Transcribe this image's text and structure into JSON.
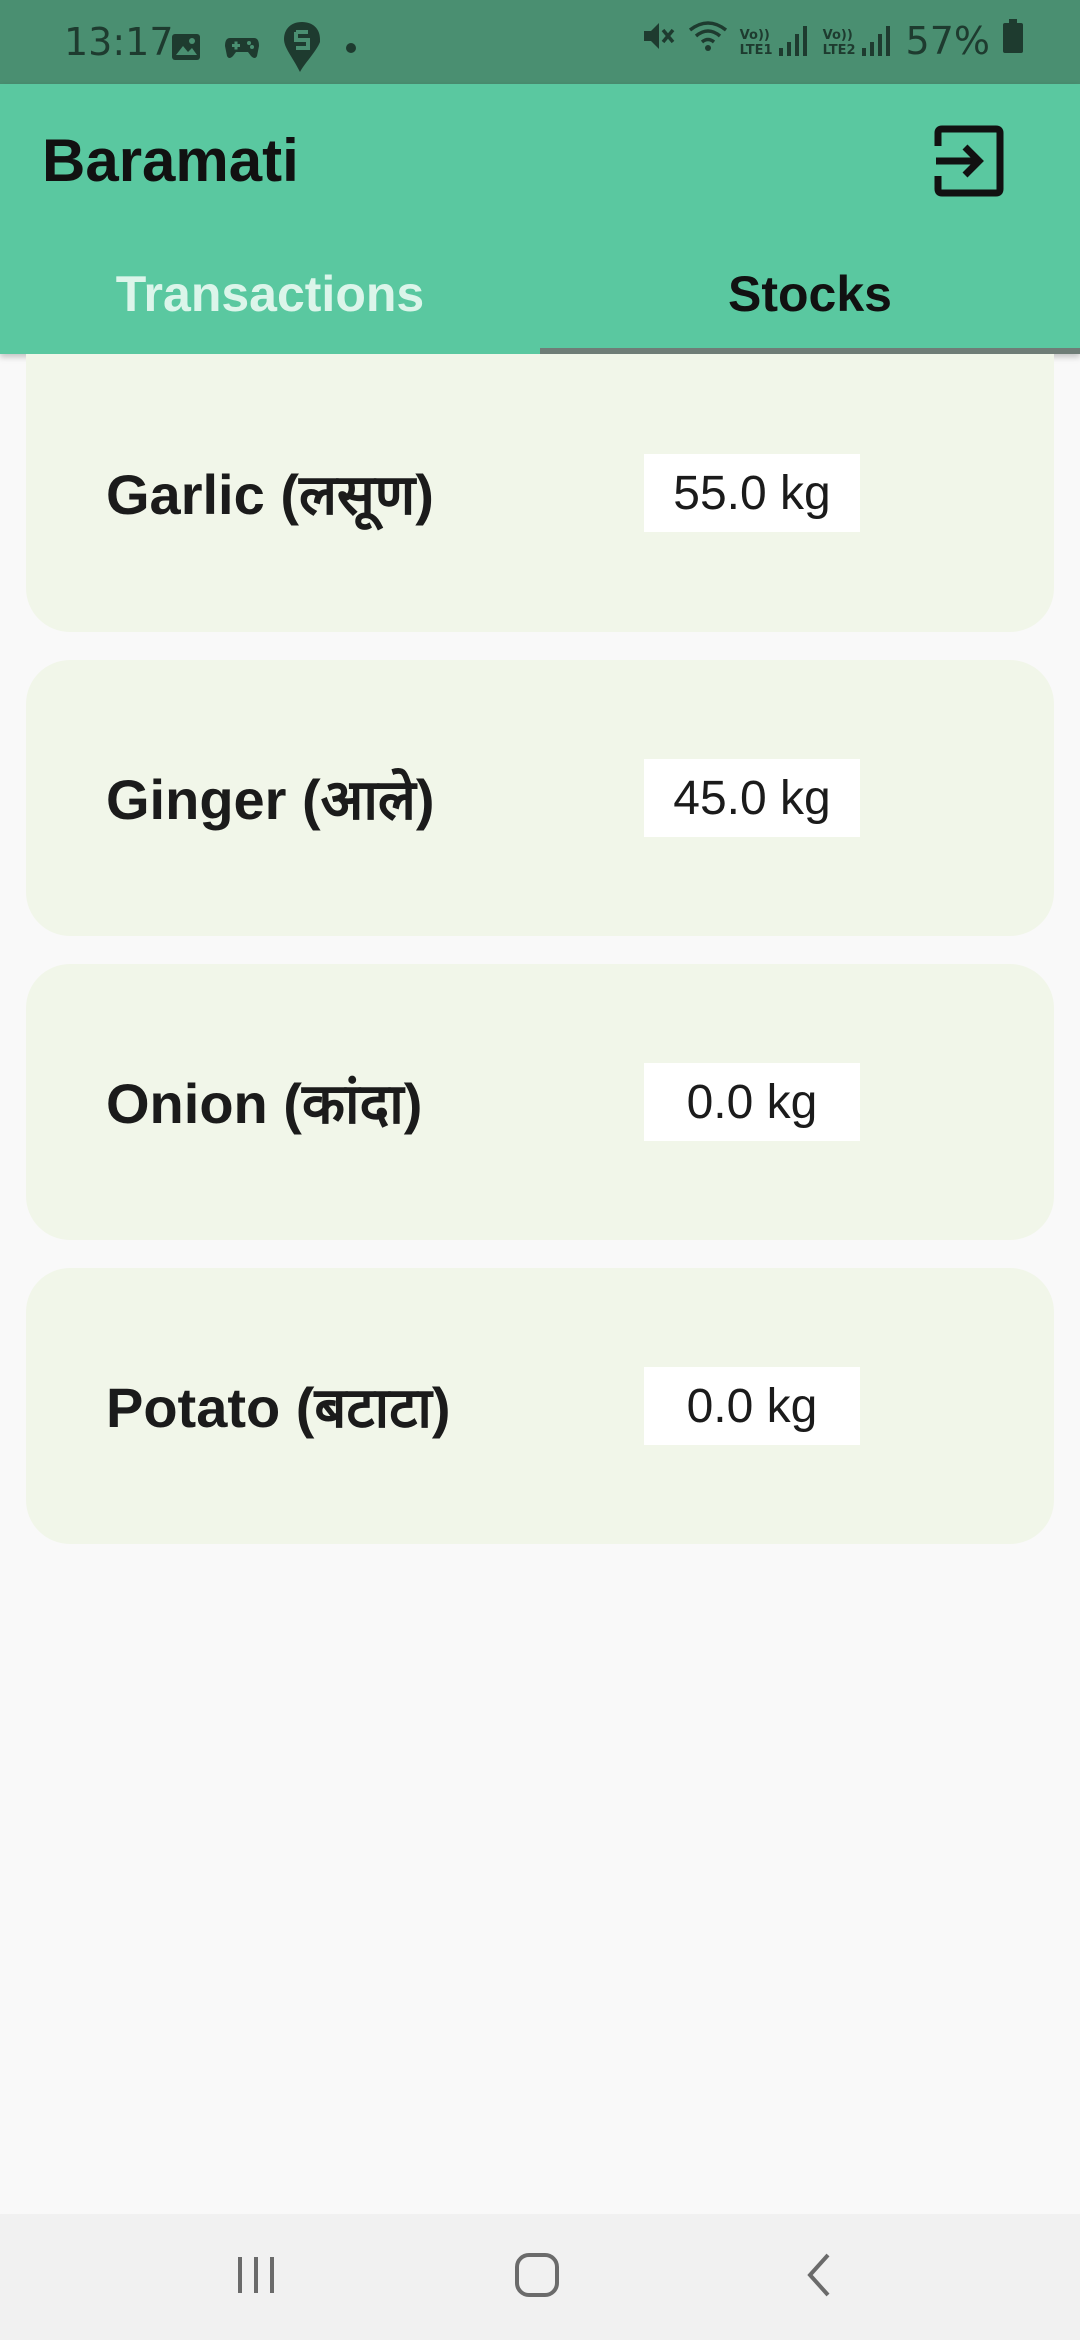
{
  "status_bar": {
    "time": "13:17",
    "battery": "57%",
    "icons": [
      "image-icon",
      "game-controller-icon",
      "swiggy-icon",
      "dot-icon",
      "mute-icon",
      "wifi-calling-icon",
      "signal-lte1-icon",
      "signal-lte2-icon",
      "battery-icon"
    ],
    "lte1_label": "LTE1",
    "lte2_label": "LTE2",
    "volte_label": "Vo))"
  },
  "app_bar": {
    "title": "Baramati",
    "logout_icon": "logout-icon",
    "background_color": "#5ac8a0"
  },
  "tabs": [
    {
      "label": "Transactions",
      "active": false
    },
    {
      "label": "Stocks",
      "active": true
    }
  ],
  "stocks": [
    {
      "name": "Garlic (लसूण)",
      "quantity": "55.0 kg"
    },
    {
      "name": "Ginger (आले)",
      "quantity": "45.0 kg"
    },
    {
      "name": "Onion (कांदा)",
      "quantity": "0.0 kg"
    },
    {
      "name": "Potato (बटाटा)",
      "quantity": "0.0 kg"
    }
  ],
  "nav_bar": {
    "buttons": [
      "recent-apps-icon",
      "home-icon",
      "back-icon"
    ]
  }
}
